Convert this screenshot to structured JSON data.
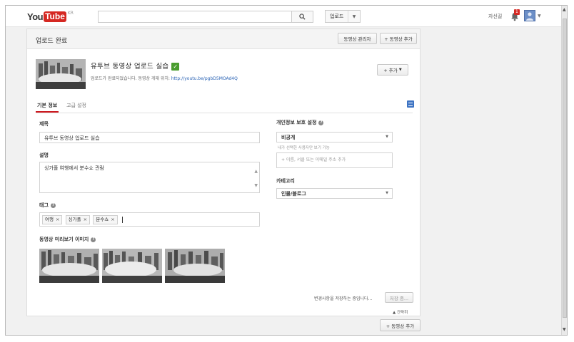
{
  "topbar": {
    "logo_you": "You",
    "logo_tube": "Tube",
    "logo_region": "KR",
    "upload_label": "업로드",
    "channel_name": "자신길",
    "notification_count": "1"
  },
  "header": {
    "title": "업로드 완료",
    "video_manager_button": "동영상 관리자",
    "add_video_button": "+ 동영상 추가"
  },
  "video": {
    "title": "유투브 동영상 업로드 실습",
    "status_text": "업로드가 완료되었습니다. 동영상 게재 위치:",
    "url": "http://youtu.be/pgbD5MOAd4Q",
    "add_more_button": "+ 추가"
  },
  "tabs": [
    {
      "label": "기본 정보",
      "active": true
    },
    {
      "label": "고급 설정",
      "active": false
    }
  ],
  "form": {
    "title_label": "제목",
    "title_value": "유투브 동영상 업로드 실습",
    "description_label": "설명",
    "description_value": "싱가폴 여행에서 분수쇼 관람",
    "tags_label": "태그",
    "tags": [
      "여행",
      "싱가폴",
      "분수쇼"
    ],
    "thumbnail_label": "동영상 미리보기 이미지",
    "privacy_label": "개인정보 보호 설정",
    "privacy_value": "비공개",
    "privacy_hint": "내가 선택한 사용자만 보기 가능",
    "share_placeholder": "+ 이름, 서클 또는 이메일 주소 추가",
    "category_label": "카테고리",
    "category_value": "인물/블로그"
  },
  "footer": {
    "saving_text": "변경사항을 저장하는 중입니다...",
    "save_button": "저장 중...",
    "collapse_link": "▲ 간략히",
    "add_video_button": "+ 동영상 추가"
  },
  "colors": {
    "brand_red": "#d52822",
    "check_green": "#4a9d2f",
    "link_blue": "#2a63b5"
  }
}
